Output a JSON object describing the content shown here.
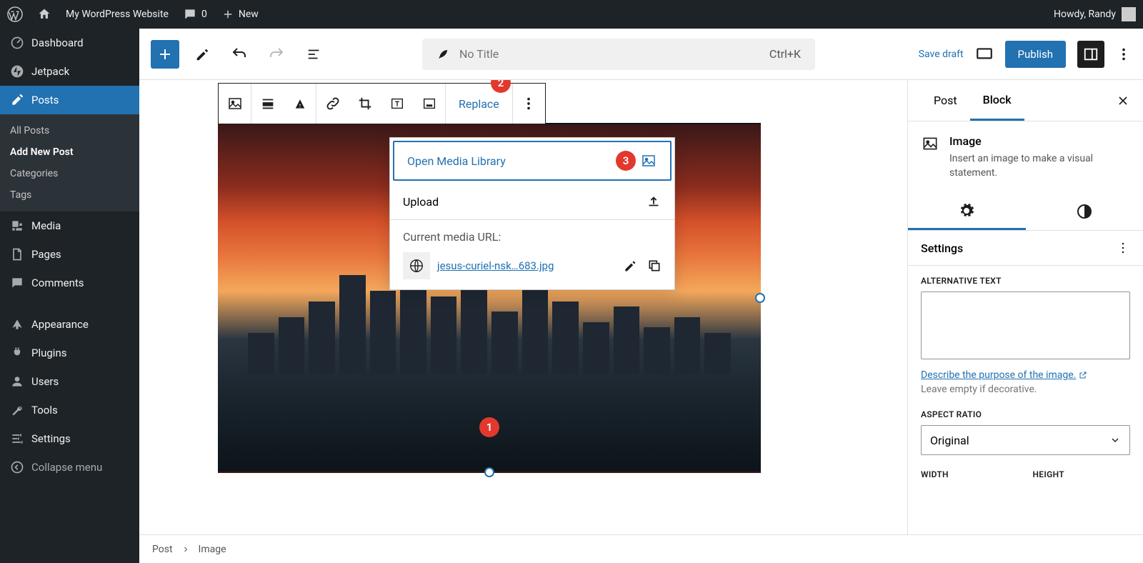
{
  "adminbar": {
    "site_title": "My WordPress Website",
    "comment_count": "0",
    "new_label": "New",
    "greeting": "Howdy, Randy"
  },
  "sidebar": {
    "items": [
      {
        "label": "Dashboard"
      },
      {
        "label": "Jetpack"
      },
      {
        "label": "Posts"
      },
      {
        "label": "Media"
      },
      {
        "label": "Pages"
      },
      {
        "label": "Comments"
      },
      {
        "label": "Appearance"
      },
      {
        "label": "Plugins"
      },
      {
        "label": "Users"
      },
      {
        "label": "Tools"
      },
      {
        "label": "Settings"
      },
      {
        "label": "Collapse menu"
      }
    ],
    "posts_sub": [
      {
        "label": "All Posts"
      },
      {
        "label": "Add New Post"
      },
      {
        "label": "Categories"
      },
      {
        "label": "Tags"
      }
    ]
  },
  "editor_header": {
    "title_placeholder": "No Title",
    "shortcut": "Ctrl+K",
    "save_draft": "Save draft",
    "publish": "Publish"
  },
  "block_toolbar": {
    "replace_label": "Replace"
  },
  "replace_popup": {
    "open_media": "Open Media Library",
    "upload": "Upload",
    "current_url_label": "Current media URL:",
    "url_text": "jesus-curiel-nsk…683.jpg"
  },
  "badges": {
    "one": "1",
    "two": "2",
    "three": "3"
  },
  "panel": {
    "tab_post": "Post",
    "tab_block": "Block",
    "block_name": "Image",
    "block_desc": "Insert an image to make a visual statement.",
    "settings_header": "Settings",
    "alt_label": "Alternative Text",
    "alt_link": "Describe the purpose of the image.",
    "alt_note": "Leave empty if decorative.",
    "aspect_label": "Aspect Ratio",
    "aspect_value": "Original",
    "width_label": "Width",
    "height_label": "Height"
  },
  "breadcrumb": {
    "post": "Post",
    "image": "Image"
  }
}
